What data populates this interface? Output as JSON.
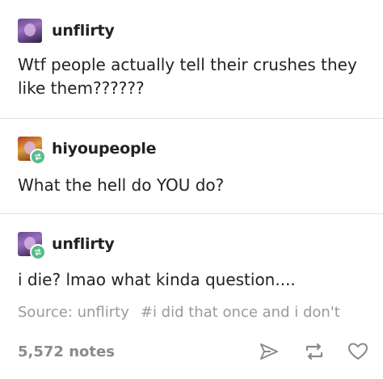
{
  "posts": [
    {
      "username": "unflirty",
      "text": "Wtf people actually tell their crushes they like them??????",
      "reblogged": false
    },
    {
      "username": "hiyoupeople",
      "text": "What the hell do YOU do?",
      "reblogged": true
    },
    {
      "username": "unflirty",
      "text": "i die? lmao what kinda question....",
      "reblogged": true
    }
  ],
  "source": {
    "label": "Source: unflirty",
    "tag": "#i did that once and i don't"
  },
  "footer": {
    "notes": "5,572 notes"
  },
  "icons": {
    "share": "paper-plane-icon",
    "reblog": "reblog-icon",
    "like": "heart-icon"
  },
  "colors": {
    "reblog_badge": "#56bc8a",
    "muted_text": "#9a9a9a"
  }
}
